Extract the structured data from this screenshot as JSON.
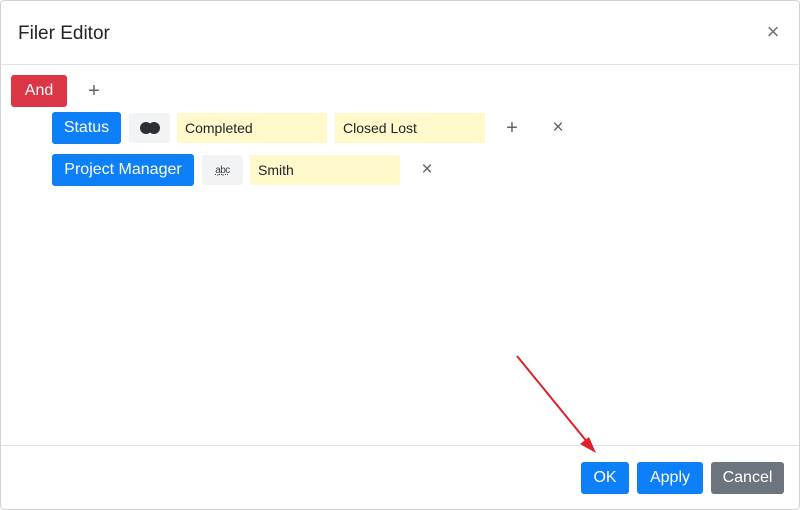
{
  "dialog": {
    "title": "Filer Editor",
    "close_icon": "close-icon"
  },
  "group": {
    "logic_label": "And",
    "add_icon": "plus-icon"
  },
  "conditions": [
    {
      "field": "Status",
      "operator_icon": "in-list-icon",
      "values": [
        "Completed",
        "Closed Lost"
      ],
      "add_icon": "plus-icon",
      "remove_icon": "close-icon"
    },
    {
      "field": "Project Manager",
      "operator_icon": "contains-text-icon",
      "operator_glyph": "a͙b͙c",
      "values": [
        "Smith"
      ],
      "remove_icon": "close-icon"
    }
  ],
  "footer": {
    "ok_label": "OK",
    "apply_label": "Apply",
    "cancel_label": "Cancel"
  },
  "colors": {
    "danger": "#dc3545",
    "primary": "#0d7ff9",
    "secondary": "#6c757d",
    "value_bg": "#fff9cc",
    "annotation_arrow": "#e0202a"
  }
}
